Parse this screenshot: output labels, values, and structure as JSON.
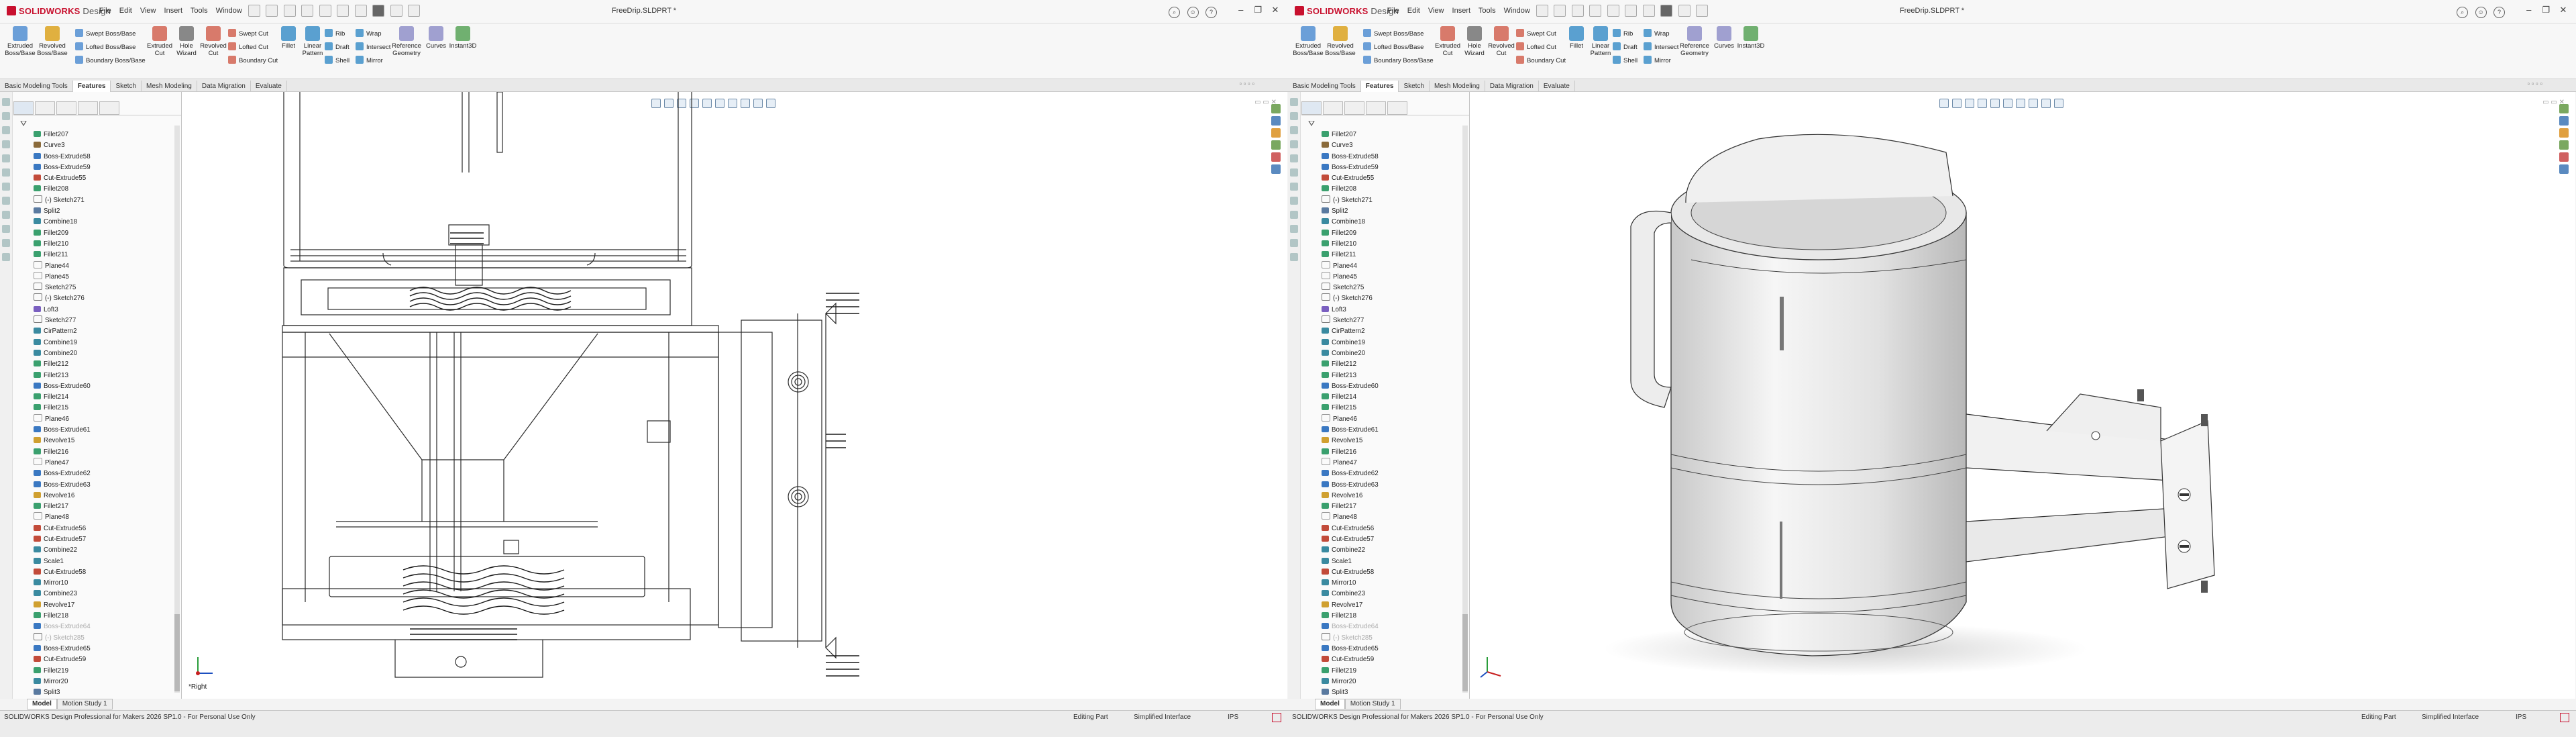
{
  "app": {
    "name": "SOLIDWORKS",
    "edition": "Design"
  },
  "menu": [
    "File",
    "Edit",
    "View",
    "Insert",
    "Tools",
    "Window"
  ],
  "document_title": "FreeDrip.SLDPRT *",
  "ribbon": {
    "buttons": [
      {
        "label": "Extruded\nBoss/Base"
      },
      {
        "label": "Revolved\nBoss/Base"
      },
      {
        "label": "Extruded\nCut"
      },
      {
        "label": "Hole\nWizard"
      },
      {
        "label": "Revolved\nCut"
      },
      {
        "label": "Fillet"
      },
      {
        "label": "Linear\nPattern"
      },
      {
        "label": "Reference\nGeometry"
      },
      {
        "label": "Curves"
      },
      {
        "label": "Instant3D"
      }
    ],
    "small": [
      "Swept Boss/Base",
      "Lofted Boss/Base",
      "Boundary Boss/Base",
      "Swept Cut",
      "Lofted Cut",
      "Boundary Cut",
      "Rib",
      "Draft",
      "Shell",
      "Wrap",
      "Intersect",
      "Mirror"
    ]
  },
  "tabs": [
    "Basic Modeling Tools",
    "Features",
    "Sketch",
    "Mesh Modeling",
    "Data Migration",
    "Evaluate"
  ],
  "active_tab": "Features",
  "feature_tree": [
    {
      "label": "Fillet207",
      "t": "f"
    },
    {
      "label": "Curve3",
      "t": "c"
    },
    {
      "label": "Boss-Extrude58",
      "t": "b",
      "exp": true
    },
    {
      "label": "Boss-Extrude59",
      "t": "b",
      "exp": true
    },
    {
      "label": "Cut-Extrude55",
      "t": "x",
      "exp": true
    },
    {
      "label": "Fillet208",
      "t": "f"
    },
    {
      "label": "(-) Sketch271",
      "t": "s"
    },
    {
      "label": "Split2",
      "t": "p"
    },
    {
      "label": "Combine18",
      "t": "m"
    },
    {
      "label": "Fillet209",
      "t": "f"
    },
    {
      "label": "Fillet210",
      "t": "f"
    },
    {
      "label": "Fillet211",
      "t": "f"
    },
    {
      "label": "Plane44",
      "t": "pl"
    },
    {
      "label": "Plane45",
      "t": "pl"
    },
    {
      "label": "Sketch275",
      "t": "s"
    },
    {
      "label": "(-) Sketch276",
      "t": "s"
    },
    {
      "label": "Loft3",
      "t": "l",
      "exp": true
    },
    {
      "label": "Sketch277",
      "t": "s"
    },
    {
      "label": "CirPattern2",
      "t": "m"
    },
    {
      "label": "Combine19",
      "t": "m"
    },
    {
      "label": "Combine20",
      "t": "m"
    },
    {
      "label": "Fillet212",
      "t": "f"
    },
    {
      "label": "Fillet213",
      "t": "f"
    },
    {
      "label": "Boss-Extrude60",
      "t": "b",
      "exp": true
    },
    {
      "label": "Fillet214",
      "t": "f"
    },
    {
      "label": "Fillet215",
      "t": "f"
    },
    {
      "label": "Plane46",
      "t": "pl"
    },
    {
      "label": "Boss-Extrude61",
      "t": "b",
      "exp": true
    },
    {
      "label": "Revolve15",
      "t": "r",
      "exp": true
    },
    {
      "label": "Fillet216",
      "t": "f"
    },
    {
      "label": "Plane47",
      "t": "pl"
    },
    {
      "label": "Boss-Extrude62",
      "t": "b",
      "exp": true
    },
    {
      "label": "Boss-Extrude63",
      "t": "b",
      "exp": true
    },
    {
      "label": "Revolve16",
      "t": "r",
      "exp": true
    },
    {
      "label": "Fillet217",
      "t": "f"
    },
    {
      "label": "Plane48",
      "t": "pl"
    },
    {
      "label": "Cut-Extrude56",
      "t": "x",
      "exp": true
    },
    {
      "label": "Cut-Extrude57",
      "t": "x",
      "exp": true
    },
    {
      "label": "Combine22",
      "t": "m"
    },
    {
      "label": "Scale1",
      "t": "m"
    },
    {
      "label": "Cut-Extrude58",
      "t": "x",
      "exp": true
    },
    {
      "label": "Mirror10",
      "t": "m"
    },
    {
      "label": "Combine23",
      "t": "m"
    },
    {
      "label": "Revolve17",
      "t": "r",
      "exp": true
    },
    {
      "label": "Fillet218",
      "t": "f"
    },
    {
      "label": "Boss-Extrude64",
      "t": "b",
      "exp": true,
      "dim": true
    },
    {
      "label": "(-) Sketch285",
      "t": "s",
      "dim": true
    },
    {
      "label": "Boss-Extrude65",
      "t": "b",
      "exp": true
    },
    {
      "label": "Cut-Extrude59",
      "t": "x",
      "exp": true
    },
    {
      "label": "Fillet219",
      "t": "f"
    },
    {
      "label": "Mirror20",
      "t": "m"
    },
    {
      "label": "Split3",
      "t": "p"
    }
  ],
  "bottom_tabs": [
    "Model",
    "Motion Study 1"
  ],
  "view_label_left": "*Right",
  "status": {
    "left": "SOLIDWORKS Design Professional for Makers 2026 SP1.0 - For Personal Use Only",
    "editing": "Editing Part",
    "interface": "Simplified Interface",
    "units": "IPS"
  },
  "colors": {
    "brand": "#c8102e",
    "boss": "#3a78c2",
    "cut": "#c24b3a",
    "fillet": "#3aa06e",
    "sketch": "#7a7a7a"
  }
}
